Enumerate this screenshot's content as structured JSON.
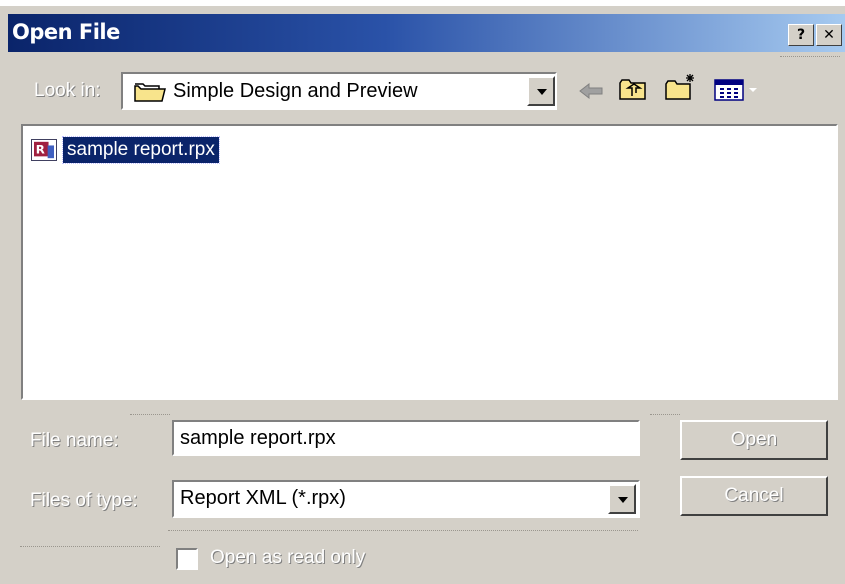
{
  "dialog": {
    "title": "Open File",
    "help_button": "?",
    "close_button": "✕"
  },
  "lookin": {
    "label": "Look in:",
    "value": "Simple Design and Preview"
  },
  "toolbar": {
    "icons": [
      "back-arrow-icon",
      "up-folder-icon",
      "new-folder-icon",
      "view-menu-icon"
    ]
  },
  "files": [
    {
      "name": "sample report.rpx",
      "icon": "rpx-file-icon",
      "selected": true
    }
  ],
  "filename": {
    "label": "File name:",
    "value": "sample report.rpx"
  },
  "filetype": {
    "label": "Files of type:",
    "value": "Report XML (*.rpx)"
  },
  "buttons": {
    "open": "Open",
    "cancel": "Cancel"
  },
  "readonly": {
    "label": "Open as read only",
    "checked": false
  },
  "colors": {
    "titlebar_start": "#0a246a",
    "titlebar_end": "#a6caf0",
    "face": "#d4d0c8",
    "selection": "#0a246a"
  }
}
